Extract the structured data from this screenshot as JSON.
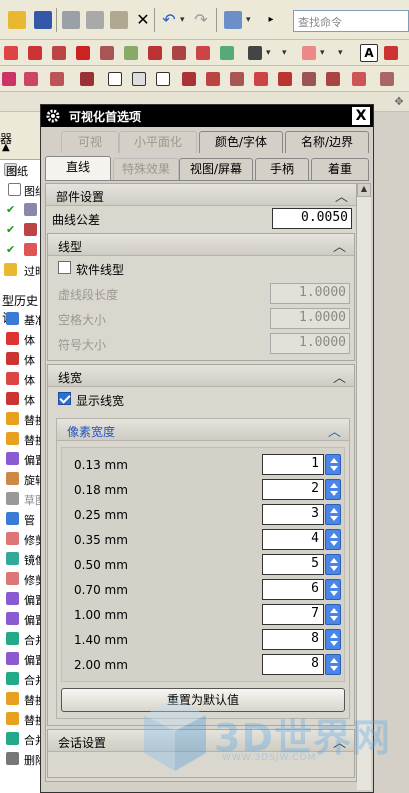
{
  "search": {
    "placeholder": "查找命令"
  },
  "left_panel": {
    "title": "器",
    "rows": [
      {
        "text": "图纸"
      },
      {
        "text": "图纸"
      },
      {
        "text": ""
      },
      {
        "text": ""
      },
      {
        "text": ""
      },
      {
        "text": "过时"
      }
    ],
    "history_title": "型历史记",
    "history": [
      {
        "text": "基准"
      },
      {
        "text": "体"
      },
      {
        "text": "体"
      },
      {
        "text": "体"
      },
      {
        "text": "体"
      },
      {
        "text": "替换"
      },
      {
        "text": "替换"
      },
      {
        "text": "偏置"
      },
      {
        "text": "旋转"
      },
      {
        "text": "草图"
      },
      {
        "text": "管"
      },
      {
        "text": "修剪"
      },
      {
        "text": "镜像"
      },
      {
        "text": "修剪"
      },
      {
        "text": "偏置"
      },
      {
        "text": "偏置"
      },
      {
        "text": "合并"
      },
      {
        "text": "偏置"
      },
      {
        "text": "合并"
      },
      {
        "text": "替换"
      },
      {
        "text": "替换"
      },
      {
        "text": "合并"
      },
      {
        "text": "删除"
      }
    ]
  },
  "dialog": {
    "title": "可视化首选项",
    "close": "X",
    "tabs_row1": [
      {
        "label": "可视",
        "disabled": true
      },
      {
        "label": "小平面化",
        "disabled": true
      },
      {
        "label": "颜色/字体",
        "disabled": false
      },
      {
        "label": "名称/边界",
        "disabled": false
      }
    ],
    "tabs_row2": [
      {
        "label": "直线",
        "active": true
      },
      {
        "label": "特殊效果",
        "disabled": true
      },
      {
        "label": "视图/屏幕",
        "disabled": false
      },
      {
        "label": "手柄",
        "disabled": false
      },
      {
        "label": "着重",
        "disabled": false
      }
    ],
    "part_settings": {
      "header": "部件设置",
      "curve_tolerance_label": "曲线公差",
      "curve_tolerance_value": "0.0050"
    },
    "linetype": {
      "header": "线型",
      "software_linetype_label": "软件线型",
      "software_linetype_checked": false,
      "dash_length_label": "虚线段长度",
      "dash_length_value": "1.0000",
      "space_size_label": "空格大小",
      "space_size_value": "1.0000",
      "symbol_size_label": "符号大小",
      "symbol_size_value": "1.0000"
    },
    "lineweight": {
      "header": "线宽",
      "show_lineweight_label": "显示线宽",
      "show_lineweight_checked": true,
      "pixel_width_header": "像素宽度",
      "rows": [
        {
          "label": "0.13 mm",
          "value": "1"
        },
        {
          "label": "0.18 mm",
          "value": "2"
        },
        {
          "label": "0.25 mm",
          "value": "3"
        },
        {
          "label": "0.35 mm",
          "value": "4"
        },
        {
          "label": "0.50 mm",
          "value": "5"
        },
        {
          "label": "0.70 mm",
          "value": "6"
        },
        {
          "label": "1.00 mm",
          "value": "7"
        },
        {
          "label": "1.40 mm",
          "value": "8"
        },
        {
          "label": "2.00 mm",
          "value": "8"
        }
      ],
      "reset_label": "重置为默认值"
    },
    "session_settings": {
      "header": "会话设置"
    }
  },
  "watermark": {
    "text": "3D世界网",
    "sub": "WWW.3DSJW.COM"
  },
  "colors": {
    "accent_blue": "#2255bb",
    "spin_blue": "#4a86e8",
    "check_blue": "#2a6fd6"
  }
}
